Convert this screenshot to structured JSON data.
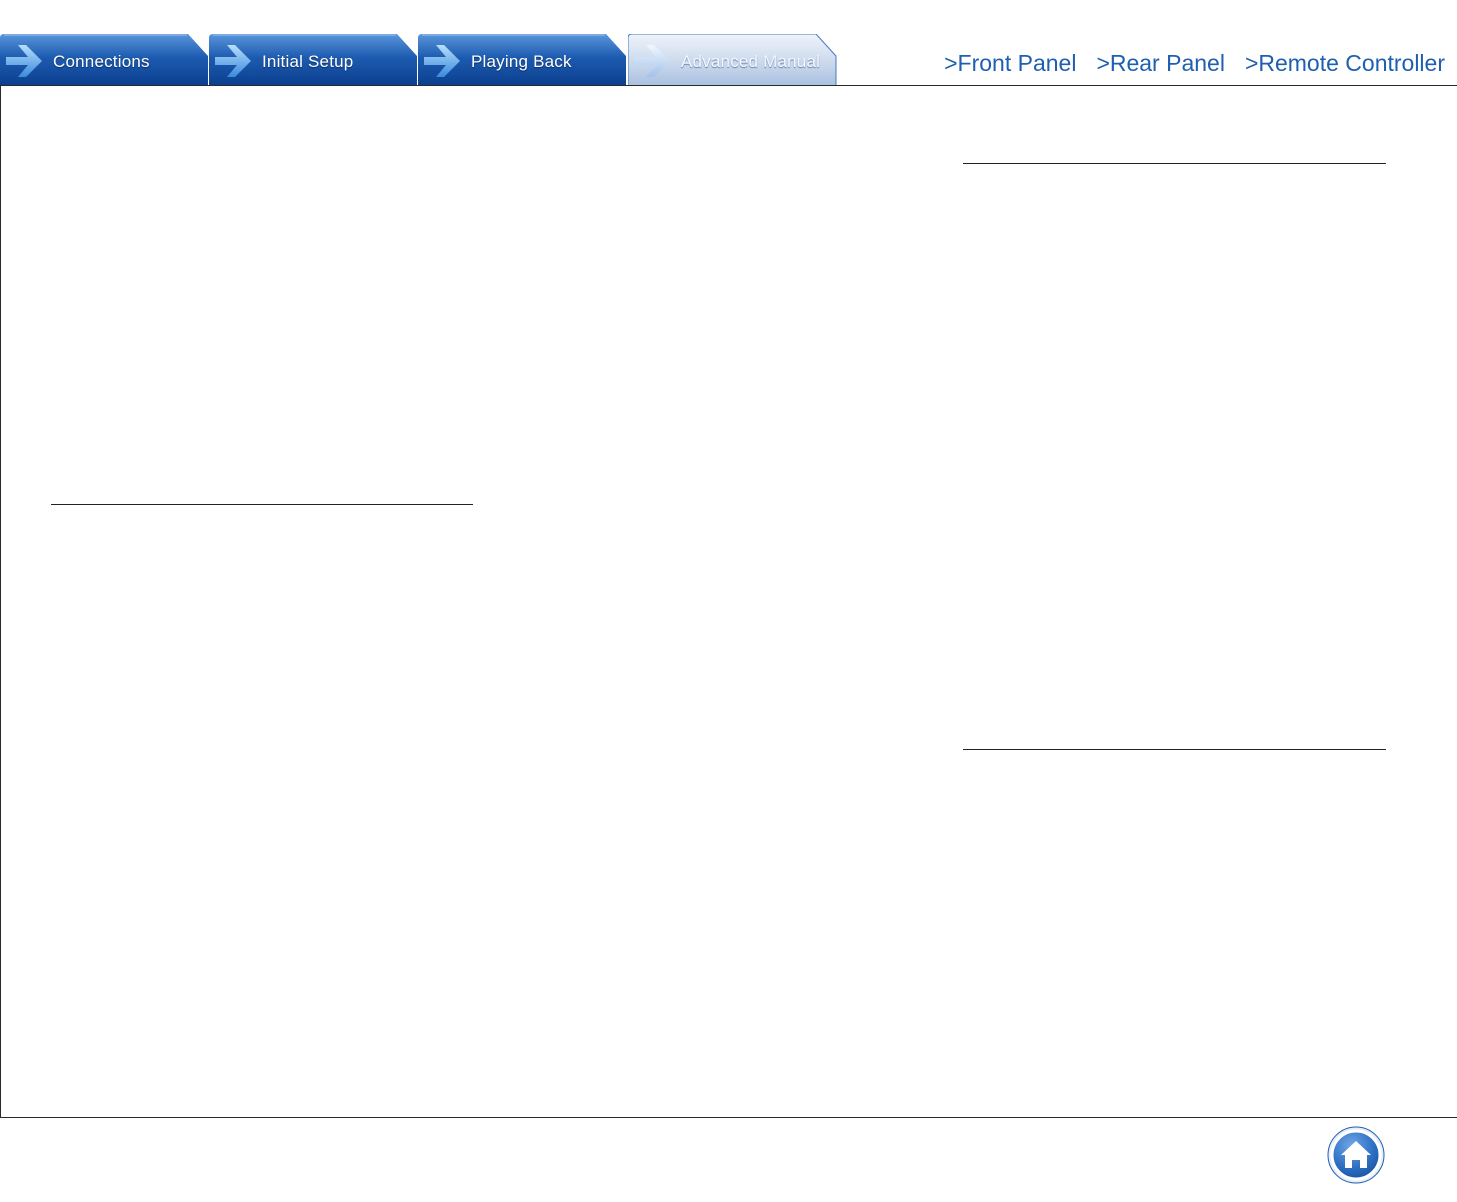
{
  "tabs": [
    {
      "label": "Connections",
      "active": false
    },
    {
      "label": "Initial Setup",
      "active": false
    },
    {
      "label": "Playing Back",
      "active": false
    },
    {
      "label": "Advanced Manual",
      "active": true
    }
  ],
  "nav_links": [
    {
      "label": ">Front Panel"
    },
    {
      "label": ">Rear Panel"
    },
    {
      "label": ">Remote Controller"
    }
  ],
  "colors": {
    "tab_blue_dark": "#0b3f8f",
    "tab_blue_light": "#3d7fd0",
    "tab_active_light": "#c9d9ee",
    "link_blue": "#1f5fb0",
    "home_blue": "#1f5fb0"
  },
  "icons": {
    "tab_arrow": "arrow-right-icon",
    "home": "home-icon"
  }
}
